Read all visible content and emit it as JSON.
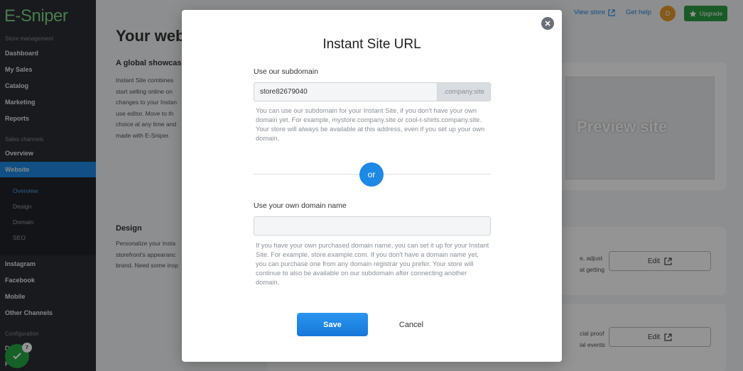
{
  "sidebar": {
    "logo": "E-Sniper",
    "sections": [
      "Store management",
      "Sales channels",
      "Configuration"
    ],
    "items": [
      "Dashboard",
      "My Sales",
      "Catalog",
      "Marketing",
      "Reports",
      "Overview",
      "Website",
      "Instagram",
      "Facebook",
      "Mobile",
      "Other Channels"
    ],
    "subitems": [
      "Overview",
      "Design",
      "Domain",
      "SEO"
    ],
    "partial_items": [
      "D",
      "P"
    ],
    "badge_count": "7"
  },
  "topbar": {
    "view_store": "View store",
    "get_help": "Get help",
    "avatar_initial": "D",
    "upgrade": "Upgrade"
  },
  "background": {
    "title": "Your web",
    "section1_title": "A global showcase",
    "section1_text": "Instant Site combines\nstart selling online on\nchanges to your Instan\nuse editor. Move to th\nchoice at any time and\nmade with E-Sniper.",
    "preview_label": "Preview site",
    "section2_title": "Design",
    "section2_text": "Personalize your Insta\nstorefront's appearanc\nbrand. Need some insp",
    "card1_text": "e, adjust\nat getting",
    "card2_text": "cial proof\nial events",
    "edit_label": "Edit"
  },
  "modal": {
    "title": "Instant Site URL",
    "subdomain_label": "Use our subdomain",
    "subdomain_value": "store82679040",
    "subdomain_suffix": ".company.site",
    "subdomain_help": "You can use our subdomain for your Instant Site, if you don't have your own domain yet. For example, mystore.company.site or cool-t-shirts.company.site. Your store will always be available at this address, even if you set up your own domain.",
    "or_label": "or",
    "own_domain_label": "Use your own domain name",
    "own_domain_value": "",
    "own_domain_help": "If you have your own purchased domain name, you can set it up for your Instant Site. For example, store.example.com. If you don't have a domain name yet, you can purchase one from any domain registrar you prefer. Your store will continue to also be available on our subdomain after connecting another domain.",
    "save_label": "Save",
    "cancel_label": "Cancel"
  },
  "colors": {
    "accent": "#1e88e5",
    "sidebar_bg": "#2a2d32",
    "upgrade_green": "#2e9c44"
  }
}
